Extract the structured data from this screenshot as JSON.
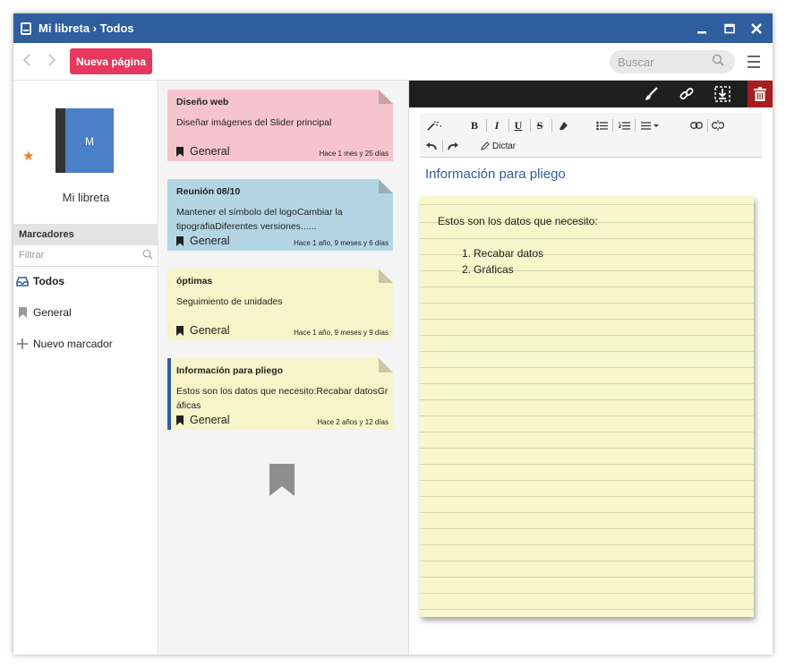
{
  "window": {
    "title": "Mi libreta › Todos"
  },
  "toolbar": {
    "new_page_label": "Nueva página",
    "search_placeholder": "Buscar"
  },
  "sidebar": {
    "notebook_letter": "M",
    "notebook_name": "Mi libreta",
    "bookmarks_header": "Marcadores",
    "filter_placeholder": "Filtrar",
    "items": [
      {
        "label": "Todos",
        "icon": "inbox-icon",
        "selected": true
      },
      {
        "label": "General",
        "icon": "bookmark-icon",
        "selected": false
      },
      {
        "label": "Nuevo marcador",
        "icon": "plus-icon",
        "selected": false
      }
    ]
  },
  "notes": [
    {
      "title": "Diseño web",
      "body": "Diseñar imágenes del Slider principal",
      "tag": "General",
      "date": "Hace 1 mes y 25 días",
      "color": "#f5c4ce"
    },
    {
      "title": "Reunión 08/10",
      "body": "Mantener el símbolo del logoCambiar la tipografiaDiferentes versiones......",
      "tag": "General",
      "date": "Hace 1 año, 9 meses y 6 días",
      "color": "#b4d6e4"
    },
    {
      "title": "óptimas",
      "body": "Seguimiento de unidades",
      "tag": "General",
      "date": "Hace 1 año, 9 meses y 9 días",
      "color": "#f6f4c8"
    },
    {
      "title": "Información para pliego",
      "body": "Estos son los datos que necesito:Recabar datosGráficas",
      "tag": "General",
      "date": "Hace 2 años y 12 días",
      "color": "#f6f4c8"
    }
  ],
  "editor": {
    "format_bold": "B",
    "format_italic": "I",
    "format_underline": "U",
    "format_strike": "S",
    "dictate_label": "Dictar",
    "title": "Información para pliego",
    "content_intro": "Estos son los datos que necesito:",
    "list": [
      "Recabar datos",
      "Gráficas"
    ],
    "list_numbers": [
      "1.",
      "2."
    ]
  },
  "colors": {
    "titlebar": "#2e5e9e",
    "new_page": "#e8375d",
    "trash": "#a71e1e",
    "star": "#f07a2a",
    "notebook": "#4a80c8"
  }
}
